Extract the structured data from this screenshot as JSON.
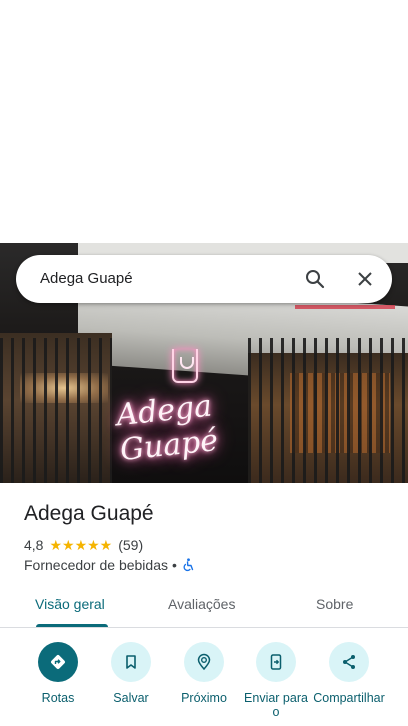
{
  "search": {
    "query": "Adega Guapé"
  },
  "photo": {
    "sign_text": "Adega Guapé"
  },
  "place": {
    "name": "Adega Guapé",
    "rating": "4,8",
    "stars": "★★★★★",
    "review_count": "(59)",
    "category": "Fornecedor de bebidas",
    "separator": "•"
  },
  "tabs": [
    {
      "label": "Visão geral",
      "active": true
    },
    {
      "label": "Avaliações",
      "active": false
    },
    {
      "label": "Sobre",
      "active": false
    }
  ],
  "actions": [
    {
      "label": "Rotas",
      "icon": "directions-icon"
    },
    {
      "label": "Salvar",
      "icon": "bookmark-icon"
    },
    {
      "label": "Próximo",
      "icon": "nearby-icon"
    },
    {
      "label": "Enviar para o",
      "icon": "send-to-phone-icon"
    },
    {
      "label": "Compartilhar",
      "icon": "share-icon"
    }
  ],
  "colors": {
    "accent": "#0b6b7a",
    "action_bg": "#d9f4f7",
    "star": "#f5b400",
    "accessibility": "#1a73e8"
  }
}
